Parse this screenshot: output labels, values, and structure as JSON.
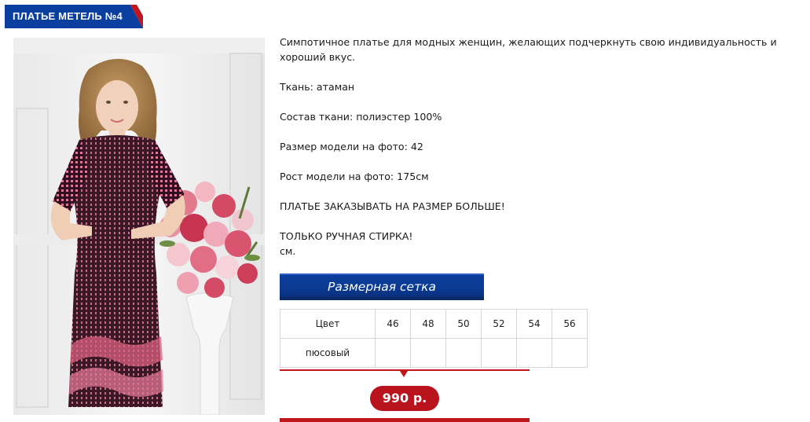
{
  "product": {
    "title": "ПЛАТЬЕ МЕТЕЛЬ №4",
    "photo_alt": "model in dress"
  },
  "description": {
    "intro": "Симпотичное платье  для модных женщин, желающих подчеркнуть свою индивидуальность и хороший вкус.",
    "fabric": "Ткань: атаман",
    "composition": "Состав ткани: полиэстер 100%",
    "model_size": "Размер модели на фото: 42",
    "model_height": "Рост модели на фото: 175см",
    "note_size": "ПЛАТЬЕ ЗАКАЗЫВАТЬ НА РАЗМЕР БОЛЬШЕ!",
    "note_wash": "ТОЛЬКО РУЧНАЯ СТИРКА!",
    "unit": "см."
  },
  "size_chart": {
    "button_label": "Размерная сетка",
    "header_label": "Цвет",
    "sizes": [
      "46",
      "48",
      "50",
      "52",
      "54",
      "56"
    ],
    "rows": [
      {
        "color": "пюсовый",
        "cells": [
          "",
          "",
          "",
          "",
          "",
          ""
        ]
      }
    ]
  },
  "price": {
    "value": "990 р."
  },
  "colors": {
    "brand_blue": "#0a3d9c",
    "accent_red": "#c0161d",
    "dress_base": "#3b1a2a",
    "dress_pink": "#d9607f"
  }
}
